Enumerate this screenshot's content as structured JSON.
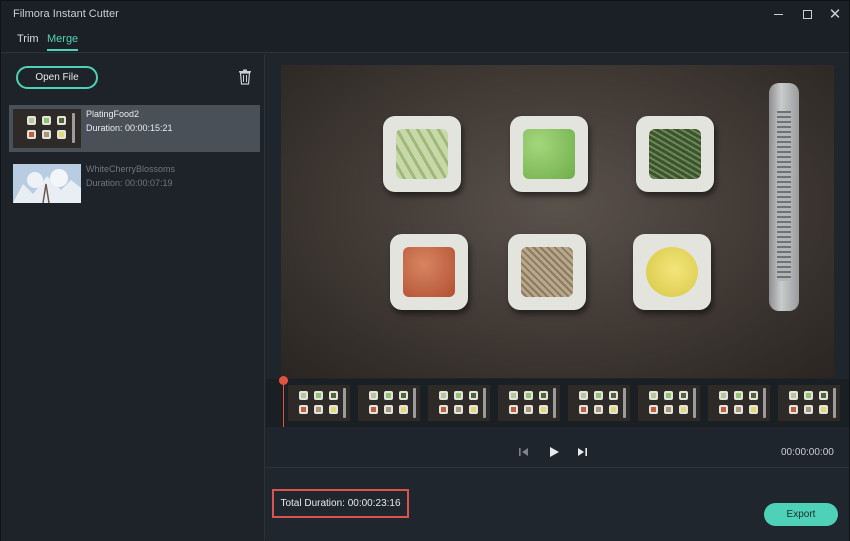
{
  "window": {
    "title": "Filmora Instant Cutter"
  },
  "tabs": [
    {
      "label": "Trim",
      "active": false
    },
    {
      "label": "Merge",
      "active": true
    }
  ],
  "sidebar": {
    "open_file_label": "Open File",
    "files": [
      {
        "name": "PlatingFood2",
        "duration": "Duration: 00:00:15:21",
        "selected": true
      },
      {
        "name": "WhiteCherryBlossoms",
        "duration": "Duration: 00:00:07:19",
        "selected": false
      }
    ]
  },
  "player": {
    "timecode": "00:00:00:00"
  },
  "footer": {
    "total_duration": "Total Duration: 00:00:23:16",
    "export_label": "Export"
  },
  "colors": {
    "accent": "#4fd1b8",
    "playhead": "#e0533f",
    "highlight_box": "#d9534f",
    "background": "#1f252c"
  },
  "icons": [
    "minimize-icon",
    "maximize-icon",
    "close-icon",
    "trash-icon",
    "prev-frame-icon",
    "play-icon",
    "next-frame-icon"
  ]
}
